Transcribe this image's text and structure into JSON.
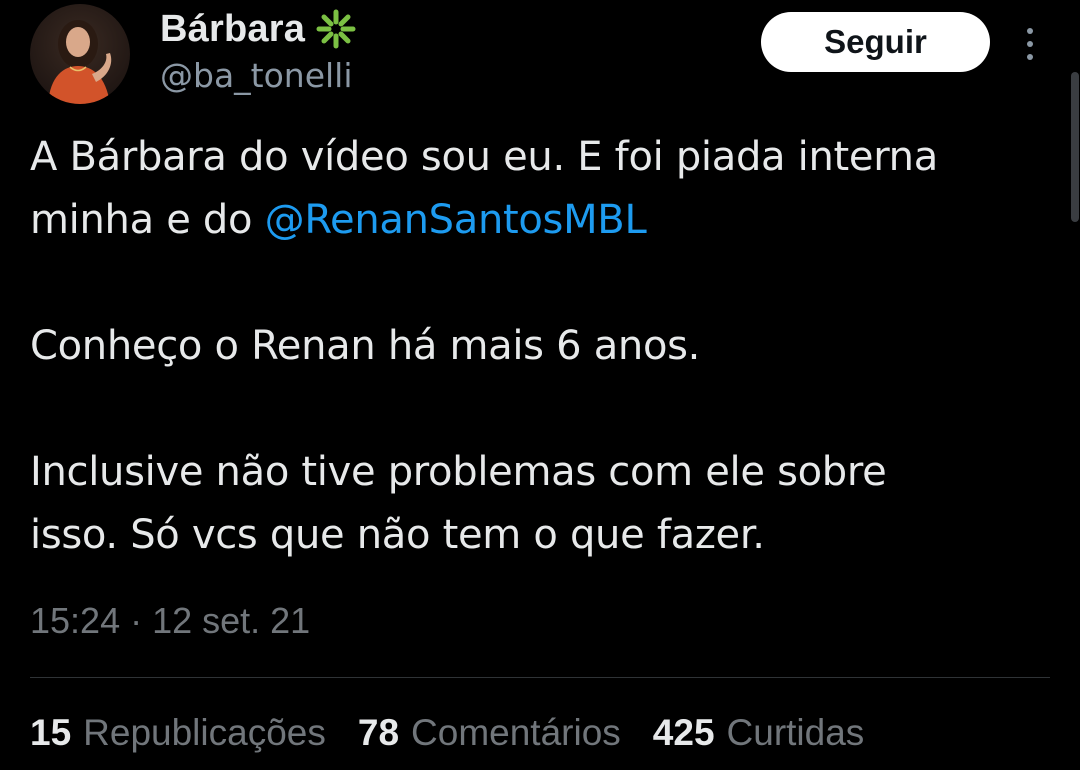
{
  "author": {
    "display_name": "Bárbara",
    "handle": "@ba_tonelli",
    "badge_icon": "sparkle-emoji-icon",
    "badge_color": "#7bc043",
    "avatar_icon": "profile-photo"
  },
  "follow_button": {
    "label": "Seguir"
  },
  "more_menu": {
    "icon": "vertical-ellipsis-icon"
  },
  "tweet": {
    "line1_pre": "A Bárbara do vídeo sou eu. E foi piada interna",
    "line2_pre": "minha e do ",
    "mention": "@RenanSantosMBL",
    "paragraph2": "Conheço o Renan há mais 6 anos.",
    "paragraph3_line1": "Inclusive não tive problemas com ele sobre",
    "paragraph3_line2": "isso. Só vcs que não tem o que fazer."
  },
  "timestamp": "15:24 · 12 set. 21",
  "stats": {
    "reposts_count": "15",
    "reposts_label": "Republicações",
    "comments_count": "78",
    "comments_label": "Comentários",
    "likes_count": "425",
    "likes_label": "Curtidas"
  },
  "colors": {
    "background": "#000000",
    "text": "#e7e9ea",
    "secondary_text": "#71767b",
    "link": "#1d9bf0",
    "button_bg": "#ffffff"
  }
}
